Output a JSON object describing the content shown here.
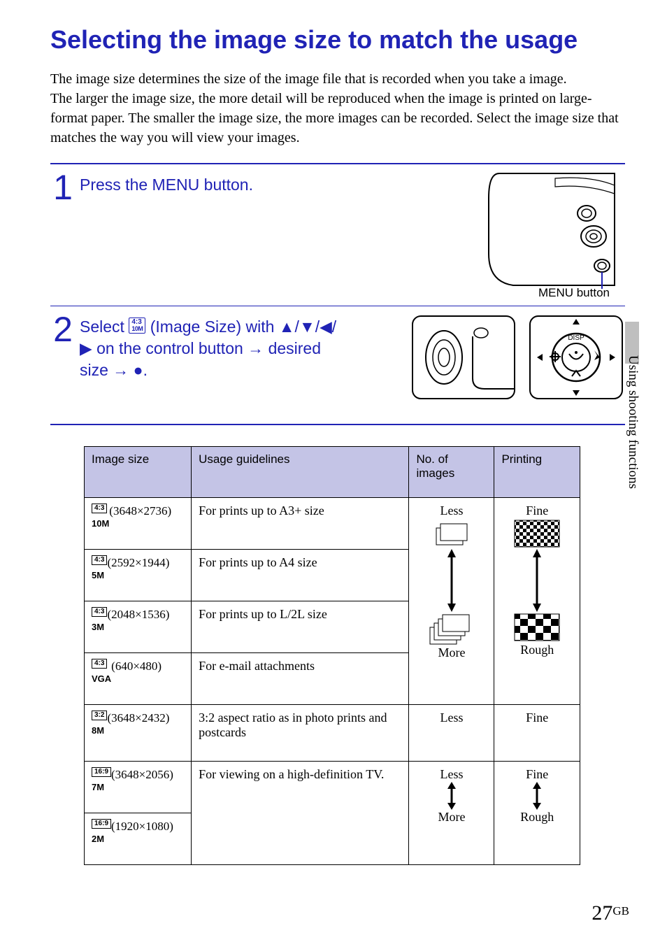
{
  "title": "Selecting the image size to match the usage",
  "intro": "The image size determines the size of the image file that is recorded when you take a image.\nThe larger the image size, the more detail will be reproduced when the image is printed on large-format paper. The smaller the image size, the more images can be recorded. Select the image size that matches the way you will view your images.",
  "steps": {
    "s1_num": "1",
    "s1_text": "Press the MENU button.",
    "s1_caption": "MENU button",
    "s2_num": "2",
    "s2_pre": "Select ",
    "s2_badge_top": "4:3",
    "s2_badge_sub": "10M",
    "s2_mid": " (Image Size) with ▲/▼/◀/▶ on the control button → desired size → ●."
  },
  "table": {
    "headers": [
      "Image size",
      "Usage guidelines",
      "No. of images",
      "Printing"
    ],
    "rows": [
      {
        "ratio": "4:3",
        "label": "10M",
        "dims": "(3648×2736)",
        "usage": "For prints up to A3+ size"
      },
      {
        "ratio": "4:3",
        "label": "5M",
        "dims": "(2592×1944)",
        "usage": "For prints up to A4 size"
      },
      {
        "ratio": "4:3",
        "label": "3M",
        "dims": "(2048×1536)",
        "usage": "For prints up to L/2L size"
      },
      {
        "ratio": "4:3",
        "label": "VGA",
        "dims": "(640×480)",
        "usage": "For e-mail attachments"
      },
      {
        "ratio": "3:2",
        "label": "8M",
        "dims": "(3648×2432)",
        "usage": "3:2 aspect ratio as in photo prints and postcards"
      },
      {
        "ratio": "16:9",
        "label": "7M",
        "dims": "(3648×2056)",
        "usage": "For viewing on a high-definition TV."
      },
      {
        "ratio": "16:9",
        "label": "2M",
        "dims": "(1920×1080)",
        "usage": ""
      }
    ],
    "scale1_top": "Less",
    "scale1_bot": "More",
    "scale2_top": "Fine",
    "scale2_bot": "Rough",
    "scale3_top": "Less",
    "scale3_bot": "More",
    "scale4_top": "Fine",
    "scale4_bot": "Rough",
    "row5_images": "Less",
    "row5_print": "Fine"
  },
  "side_tab": "Using shooting functions",
  "page_number": "27",
  "page_suffix": "GB"
}
